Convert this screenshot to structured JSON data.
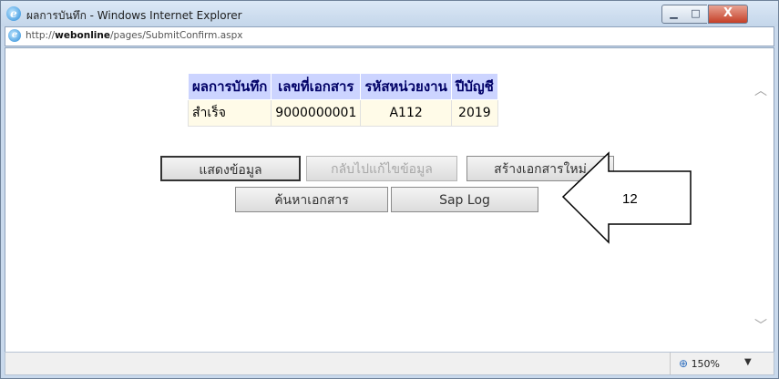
{
  "window": {
    "title": "ผลการบันทึก - Windows Internet Explorer",
    "minimize_label": "▁",
    "maximize_label": "□",
    "close_label": "X"
  },
  "address": {
    "prefix": "http://",
    "host": "webonline",
    "path": "/pages/SubmitConfirm.aspx"
  },
  "result_table": {
    "headers": [
      "ผลการบันทึก",
      "เลขที่เอกสาร",
      "รหัสหน่วยงาน",
      "ปีบัญชี"
    ],
    "row": [
      "สำเร็จ",
      "9000000001",
      "A112",
      "2019"
    ]
  },
  "buttons": {
    "show_data": "แสดงข้อมูล",
    "back_edit": "กลับไปแก้ไขข้อมูล",
    "create_new": "สร้างเอกสารใหม่",
    "search_doc": "ค้นหาเอกสาร",
    "sap_log": "Sap Log"
  },
  "status": {
    "zoom": "150%"
  },
  "annotation": {
    "label": "12"
  },
  "colors": {
    "header_bg": "#ccd4ff",
    "header_text": "#000066",
    "cell_bg": "#fffbe8",
    "frame": "#c9d9ec"
  }
}
